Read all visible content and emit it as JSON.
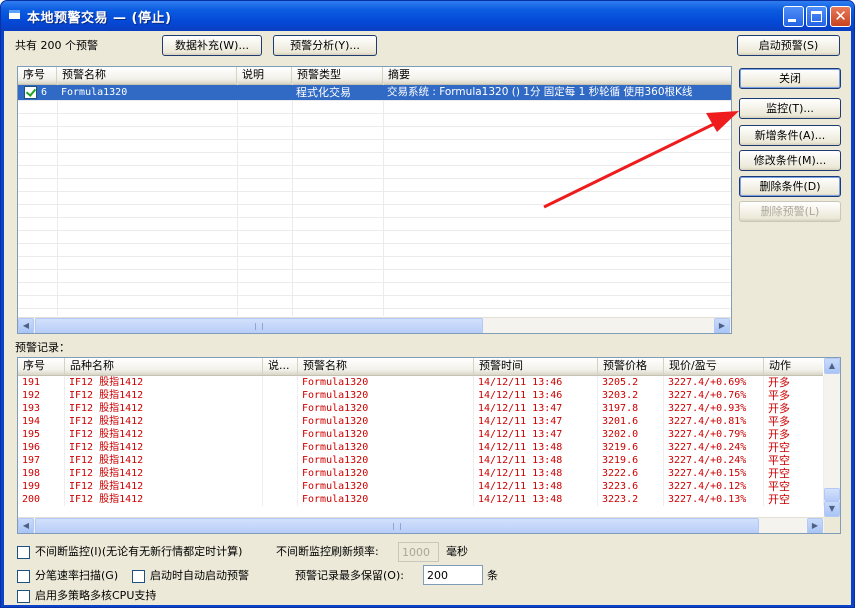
{
  "window": {
    "title": "本地预警交易 — (停止)"
  },
  "top": {
    "count_label": "共有 200 个预警",
    "data_supplement_btn": "数据补充(W)...",
    "alert_analysis_btn": "预警分析(Y)...",
    "start_alert_btn": "启动预警(S)"
  },
  "alert_list": {
    "columns": [
      "序号",
      "预警名称",
      "说明",
      "预警类型",
      "摘要"
    ],
    "rows": [
      {
        "checked": true,
        "id": "6",
        "name": "Formula1320",
        "desc": "",
        "type": "程式化交易",
        "summary": "交易系统 : Formula1320 () 1分 固定每 1 秒轮循 使用360根K线"
      }
    ]
  },
  "side_buttons": {
    "close": "关闭",
    "monitor": "监控(T)...",
    "add_condition": "新增条件(A)...",
    "modify_condition": "修改条件(M)...",
    "delete_condition": "删除条件(D)",
    "delete_alert": "删除预警(L)"
  },
  "records": {
    "label": "预警记录：",
    "columns": [
      "序号",
      "品种名称",
      "说...",
      "预警名称",
      "预警时间",
      "预警价格",
      "现价/盈亏",
      "动作"
    ],
    "rows": [
      [
        "191",
        "IF12 股指1412",
        "",
        "Formula1320",
        "14/12/11 13:46",
        "3205.2",
        "3227.4/+0.69%",
        "开多"
      ],
      [
        "192",
        "IF12 股指1412",
        "",
        "Formula1320",
        "14/12/11 13:46",
        "3203.2",
        "3227.4/+0.76%",
        "平多"
      ],
      [
        "193",
        "IF12 股指1412",
        "",
        "Formula1320",
        "14/12/11 13:47",
        "3197.8",
        "3227.4/+0.93%",
        "开多"
      ],
      [
        "194",
        "IF12 股指1412",
        "",
        "Formula1320",
        "14/12/11 13:47",
        "3201.6",
        "3227.4/+0.81%",
        "平多"
      ],
      [
        "195",
        "IF12 股指1412",
        "",
        "Formula1320",
        "14/12/11 13:47",
        "3202.0",
        "3227.4/+0.79%",
        "开多"
      ],
      [
        "196",
        "IF12 股指1412",
        "",
        "Formula1320",
        "14/12/11 13:48",
        "3219.6",
        "3227.4/+0.24%",
        "开空"
      ],
      [
        "197",
        "IF12 股指1412",
        "",
        "Formula1320",
        "14/12/11 13:48",
        "3219.6",
        "3227.4/+0.24%",
        "平空"
      ],
      [
        "198",
        "IF12 股指1412",
        "",
        "Formula1320",
        "14/12/11 13:48",
        "3222.6",
        "3227.4/+0.15%",
        "开空"
      ],
      [
        "199",
        "IF12 股指1412",
        "",
        "Formula1320",
        "14/12/11 13:48",
        "3223.6",
        "3227.4/+0.12%",
        "平空"
      ],
      [
        "200",
        "IF12 股指1412",
        "",
        "Formula1320",
        "14/12/11 13:48",
        "3223.2",
        "3227.4/+0.13%",
        "开空"
      ]
    ]
  },
  "options": {
    "continuous_monitor": "不间断监控(I)(无论有无新行情都定时计算)",
    "refresh_rate_label": "不间断监控刷新频率:",
    "refresh_rate_value": "1000",
    "ms_unit": "毫秒",
    "tick_scan": "分笔速率扫描(G)",
    "auto_start": "启动时自动启动预警",
    "max_records_label": "预警记录最多保留(O):",
    "max_records_value": "200",
    "records_unit": "条",
    "multi_cpu": "启用多策略多核CPU支持"
  },
  "colors": {
    "title_blue": "#0a42c8",
    "record_red": "#cc0000",
    "selection_blue": "#316ac5",
    "arrow_red": "#ee1c1c"
  }
}
